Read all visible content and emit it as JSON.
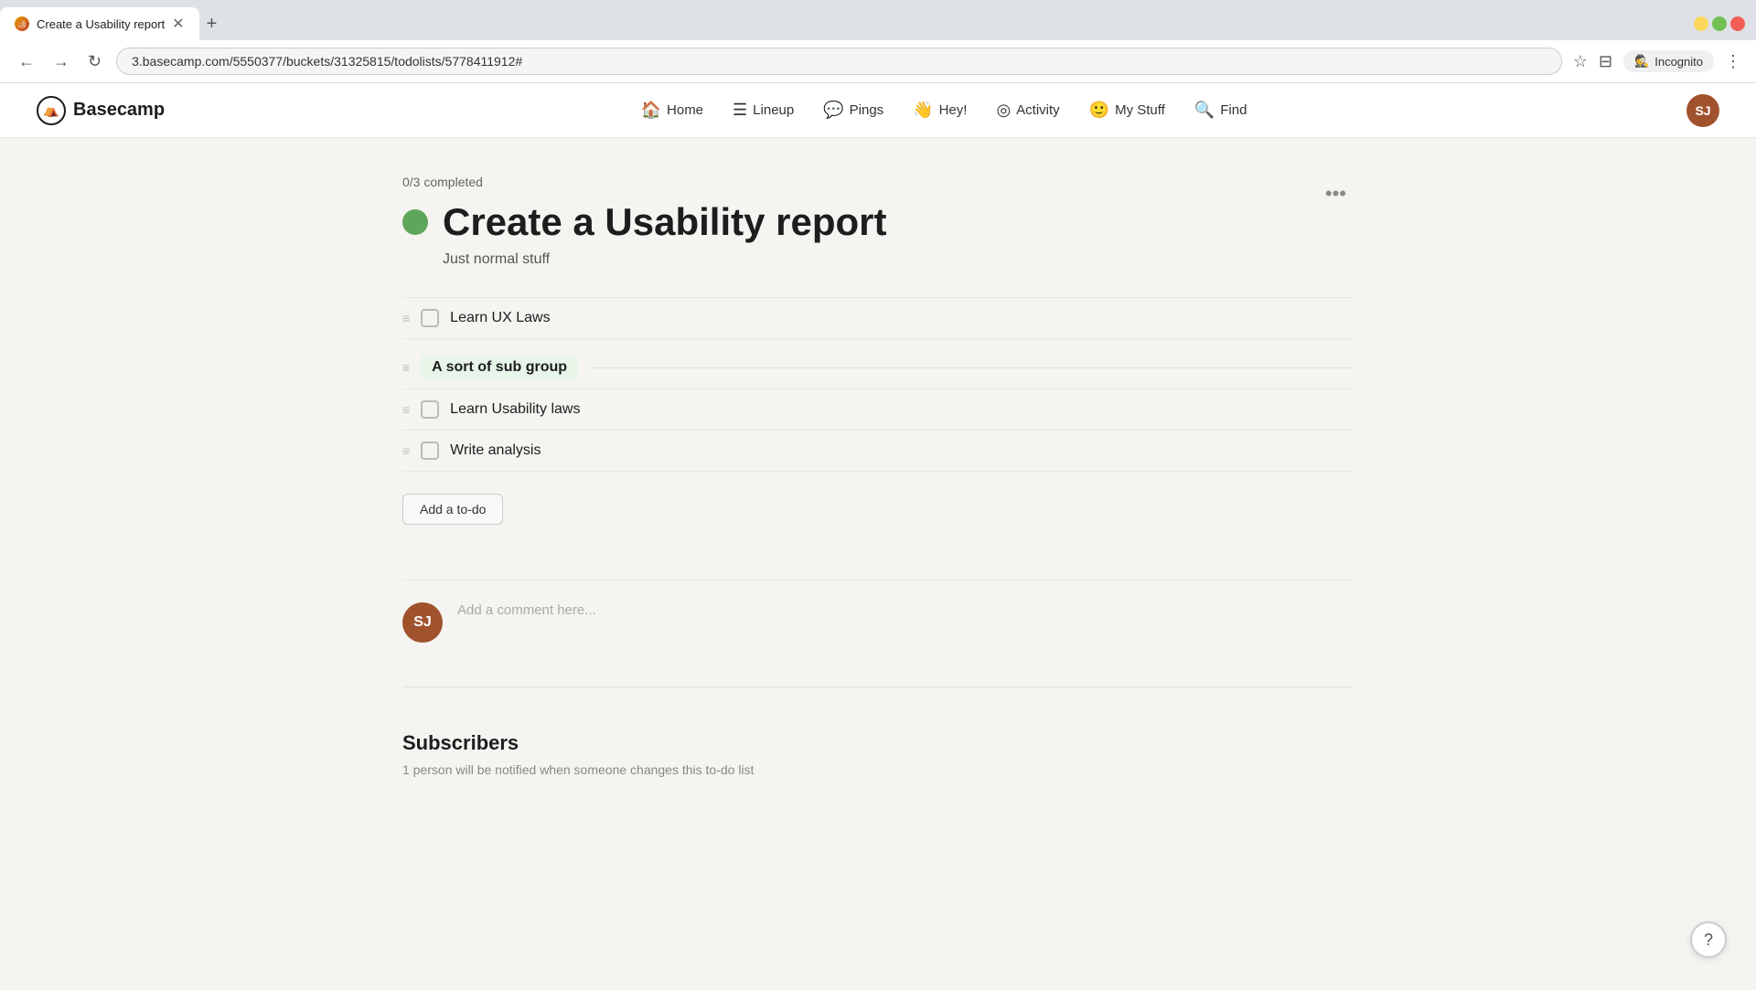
{
  "browser": {
    "tab_title": "Create a Usability report",
    "url": "3.basecamp.com/5550377/buckets/31325815/todolists/5778411912#",
    "new_tab_label": "+",
    "incognito_label": "Incognito",
    "nav_back": "←",
    "nav_forward": "→",
    "nav_refresh": "↻"
  },
  "nav": {
    "logo_text": "Basecamp",
    "links": [
      {
        "id": "home",
        "label": "Home",
        "icon": "🏠"
      },
      {
        "id": "lineup",
        "label": "Lineup",
        "icon": "≡"
      },
      {
        "id": "pings",
        "label": "Pings",
        "icon": "💬"
      },
      {
        "id": "hey",
        "label": "Hey!",
        "icon": "👋"
      },
      {
        "id": "activity",
        "label": "Activity",
        "icon": "◎"
      },
      {
        "id": "my-stuff",
        "label": "My Stuff",
        "icon": "😊"
      },
      {
        "id": "find",
        "label": "Find",
        "icon": "🔍"
      }
    ],
    "user_initials": "SJ"
  },
  "todolist": {
    "progress_text": "0/3 completed",
    "title": "Create a Usability report",
    "description": "Just normal stuff",
    "options_label": "•••",
    "items": [
      {
        "id": "item-1",
        "text": "Learn UX Laws",
        "checked": false
      }
    ],
    "subgroup": {
      "label": "A sort of sub group",
      "items": [
        {
          "id": "item-2",
          "text": "Learn Usability laws",
          "checked": false
        },
        {
          "id": "item-3",
          "text": "Write analysis",
          "checked": false
        }
      ]
    },
    "add_todo_label": "Add a to-do"
  },
  "comment_section": {
    "user_initials": "SJ",
    "placeholder": "Add a comment here..."
  },
  "subscribers": {
    "title": "Subscribers",
    "description": "1 person will be notified when someone changes this to-do list"
  },
  "help": {
    "label": "?"
  }
}
